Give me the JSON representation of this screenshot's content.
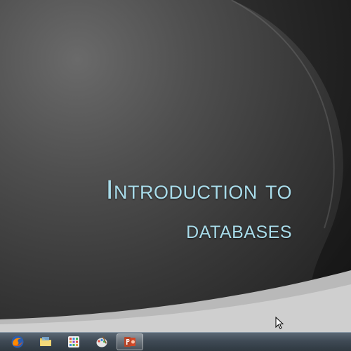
{
  "slide": {
    "title_line_1": "Introduction to",
    "title_line_2": "databases",
    "title_color": "#a9dcea"
  },
  "taskbar": {
    "items": [
      {
        "icon": "firefox-icon",
        "active": false
      },
      {
        "icon": "folder-icon",
        "active": false
      },
      {
        "icon": "app-grid-icon",
        "active": false
      },
      {
        "icon": "paint-icon",
        "active": false
      },
      {
        "icon": "powerpoint-icon",
        "active": true
      }
    ]
  }
}
